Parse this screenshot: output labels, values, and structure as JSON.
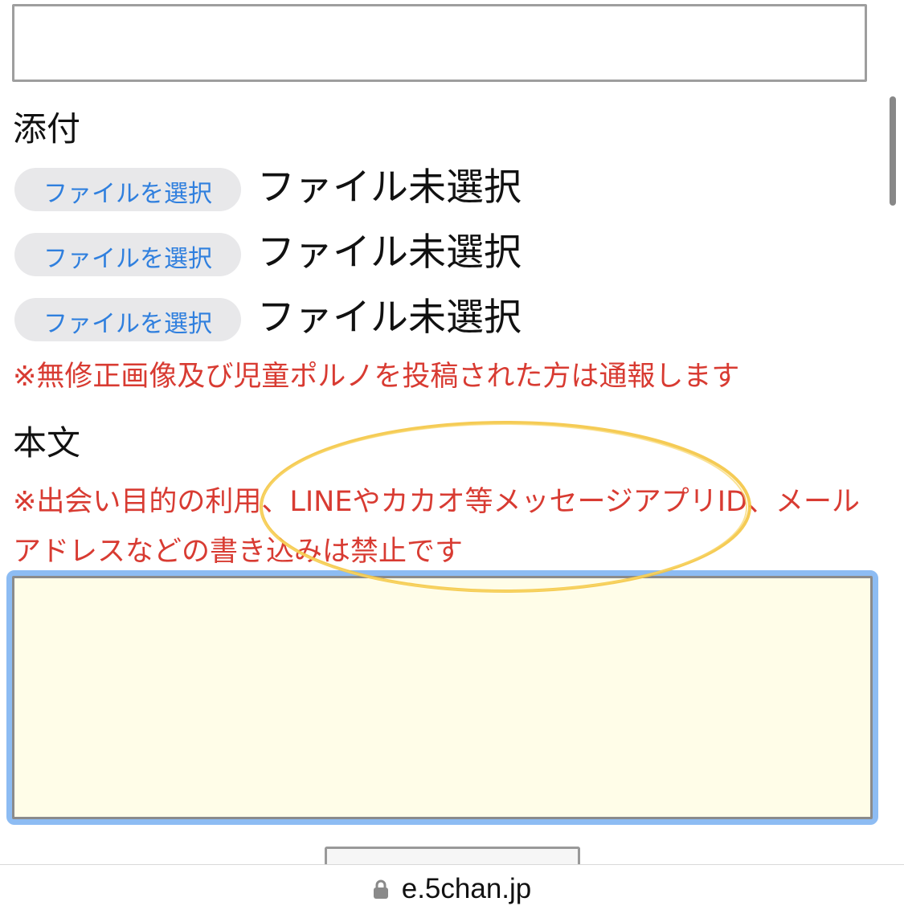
{
  "form": {
    "attachment_label": "添付",
    "file_inputs": [
      {
        "button_label": "ファイルを選択",
        "status": "ファイル未選択"
      },
      {
        "button_label": "ファイルを選択",
        "status": "ファイル未選択"
      },
      {
        "button_label": "ファイルを選択",
        "status": "ファイル未選択"
      }
    ],
    "attachment_warning": "※無修正画像及び児童ポルノを投稿された方は通報します",
    "body_label": "本文",
    "body_warning_line1": "※出会い目的の利用、LINEやカカオ等メッセージアプリID、メール",
    "body_warning_line2": "アドレスなどの書き込みは禁止です"
  },
  "browser": {
    "domain": "e.5chan.jp",
    "lock_icon": "lock-icon"
  },
  "colors": {
    "warning": "#d83b32",
    "button_text": "#2f7fde",
    "textarea_background": "#fffde8",
    "focus_ring": "#8dbcf3",
    "highlight": "#f4c542"
  }
}
